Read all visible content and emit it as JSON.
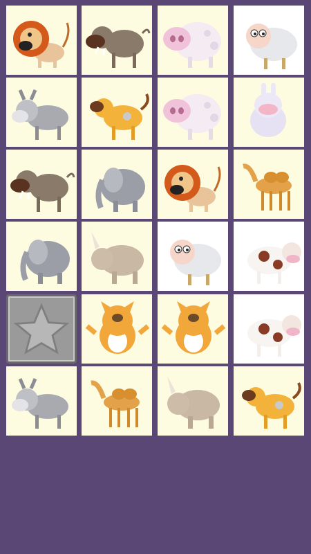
{
  "game": {
    "name": "memory-match",
    "colors": {
      "background": "#5a4776",
      "tile_face": "#fdfbe0",
      "tile_face_alt": "#ffffff",
      "tile_back": "#9a9a9a"
    },
    "rows": 6,
    "cols": 4,
    "tiles": [
      {
        "animal": "lion",
        "state": "revealed",
        "bg": "cream"
      },
      {
        "animal": "warthog",
        "state": "revealed",
        "bg": "cream"
      },
      {
        "animal": "hippo",
        "state": "revealed",
        "bg": "cream"
      },
      {
        "animal": "sheep",
        "state": "revealed",
        "bg": "white"
      },
      {
        "animal": "donkey",
        "state": "revealed",
        "bg": "cream"
      },
      {
        "animal": "dog",
        "state": "revealed",
        "bg": "cream"
      },
      {
        "animal": "hippo",
        "state": "revealed",
        "bg": "cream"
      },
      {
        "animal": "rabbit",
        "state": "revealed",
        "bg": "cream"
      },
      {
        "animal": "warthog",
        "state": "revealed",
        "bg": "cream"
      },
      {
        "animal": "elephant",
        "state": "revealed",
        "bg": "cream"
      },
      {
        "animal": "lion",
        "state": "revealed",
        "bg": "cream"
      },
      {
        "animal": "camel",
        "state": "revealed",
        "bg": "cream"
      },
      {
        "animal": "elephant",
        "state": "revealed",
        "bg": "cream"
      },
      {
        "animal": "rhino",
        "state": "revealed",
        "bg": "cream"
      },
      {
        "animal": "sheep",
        "state": "revealed",
        "bg": "white"
      },
      {
        "animal": "cow",
        "state": "revealed",
        "bg": "white"
      },
      {
        "animal": "star",
        "state": "hidden",
        "bg": "back"
      },
      {
        "animal": "cat",
        "state": "revealed",
        "bg": "cream"
      },
      {
        "animal": "cat",
        "state": "revealed",
        "bg": "cream"
      },
      {
        "animal": "cow",
        "state": "revealed",
        "bg": "white"
      },
      {
        "animal": "donkey",
        "state": "revealed",
        "bg": "cream"
      },
      {
        "animal": "camel",
        "state": "revealed",
        "bg": "cream"
      },
      {
        "animal": "rhino",
        "state": "revealed",
        "bg": "cream"
      },
      {
        "animal": "dog",
        "state": "revealed",
        "bg": "cream"
      }
    ]
  }
}
